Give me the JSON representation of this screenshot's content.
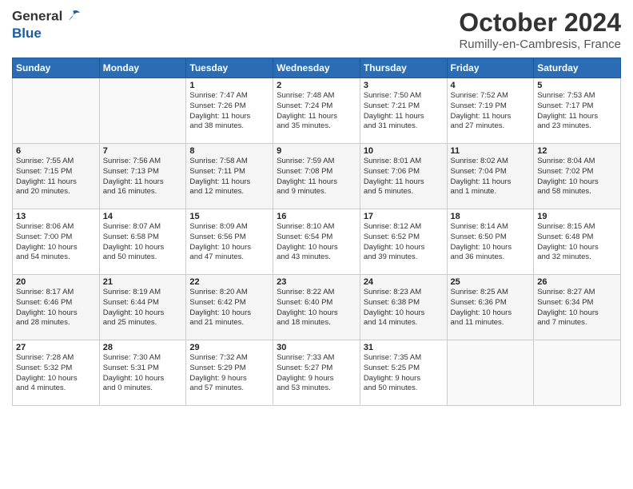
{
  "header": {
    "logo_line1": "General",
    "logo_line2": "Blue",
    "title": "October 2024",
    "subtitle": "Rumilly-en-Cambresis, France"
  },
  "calendar": {
    "days_of_week": [
      "Sunday",
      "Monday",
      "Tuesday",
      "Wednesday",
      "Thursday",
      "Friday",
      "Saturday"
    ],
    "weeks": [
      [
        {
          "day": "",
          "info": ""
        },
        {
          "day": "",
          "info": ""
        },
        {
          "day": "1",
          "info": "Sunrise: 7:47 AM\nSunset: 7:26 PM\nDaylight: 11 hours\nand 38 minutes."
        },
        {
          "day": "2",
          "info": "Sunrise: 7:48 AM\nSunset: 7:24 PM\nDaylight: 11 hours\nand 35 minutes."
        },
        {
          "day": "3",
          "info": "Sunrise: 7:50 AM\nSunset: 7:21 PM\nDaylight: 11 hours\nand 31 minutes."
        },
        {
          "day": "4",
          "info": "Sunrise: 7:52 AM\nSunset: 7:19 PM\nDaylight: 11 hours\nand 27 minutes."
        },
        {
          "day": "5",
          "info": "Sunrise: 7:53 AM\nSunset: 7:17 PM\nDaylight: 11 hours\nand 23 minutes."
        }
      ],
      [
        {
          "day": "6",
          "info": "Sunrise: 7:55 AM\nSunset: 7:15 PM\nDaylight: 11 hours\nand 20 minutes."
        },
        {
          "day": "7",
          "info": "Sunrise: 7:56 AM\nSunset: 7:13 PM\nDaylight: 11 hours\nand 16 minutes."
        },
        {
          "day": "8",
          "info": "Sunrise: 7:58 AM\nSunset: 7:11 PM\nDaylight: 11 hours\nand 12 minutes."
        },
        {
          "day": "9",
          "info": "Sunrise: 7:59 AM\nSunset: 7:08 PM\nDaylight: 11 hours\nand 9 minutes."
        },
        {
          "day": "10",
          "info": "Sunrise: 8:01 AM\nSunset: 7:06 PM\nDaylight: 11 hours\nand 5 minutes."
        },
        {
          "day": "11",
          "info": "Sunrise: 8:02 AM\nSunset: 7:04 PM\nDaylight: 11 hours\nand 1 minute."
        },
        {
          "day": "12",
          "info": "Sunrise: 8:04 AM\nSunset: 7:02 PM\nDaylight: 10 hours\nand 58 minutes."
        }
      ],
      [
        {
          "day": "13",
          "info": "Sunrise: 8:06 AM\nSunset: 7:00 PM\nDaylight: 10 hours\nand 54 minutes."
        },
        {
          "day": "14",
          "info": "Sunrise: 8:07 AM\nSunset: 6:58 PM\nDaylight: 10 hours\nand 50 minutes."
        },
        {
          "day": "15",
          "info": "Sunrise: 8:09 AM\nSunset: 6:56 PM\nDaylight: 10 hours\nand 47 minutes."
        },
        {
          "day": "16",
          "info": "Sunrise: 8:10 AM\nSunset: 6:54 PM\nDaylight: 10 hours\nand 43 minutes."
        },
        {
          "day": "17",
          "info": "Sunrise: 8:12 AM\nSunset: 6:52 PM\nDaylight: 10 hours\nand 39 minutes."
        },
        {
          "day": "18",
          "info": "Sunrise: 8:14 AM\nSunset: 6:50 PM\nDaylight: 10 hours\nand 36 minutes."
        },
        {
          "day": "19",
          "info": "Sunrise: 8:15 AM\nSunset: 6:48 PM\nDaylight: 10 hours\nand 32 minutes."
        }
      ],
      [
        {
          "day": "20",
          "info": "Sunrise: 8:17 AM\nSunset: 6:46 PM\nDaylight: 10 hours\nand 28 minutes."
        },
        {
          "day": "21",
          "info": "Sunrise: 8:19 AM\nSunset: 6:44 PM\nDaylight: 10 hours\nand 25 minutes."
        },
        {
          "day": "22",
          "info": "Sunrise: 8:20 AM\nSunset: 6:42 PM\nDaylight: 10 hours\nand 21 minutes."
        },
        {
          "day": "23",
          "info": "Sunrise: 8:22 AM\nSunset: 6:40 PM\nDaylight: 10 hours\nand 18 minutes."
        },
        {
          "day": "24",
          "info": "Sunrise: 8:23 AM\nSunset: 6:38 PM\nDaylight: 10 hours\nand 14 minutes."
        },
        {
          "day": "25",
          "info": "Sunrise: 8:25 AM\nSunset: 6:36 PM\nDaylight: 10 hours\nand 11 minutes."
        },
        {
          "day": "26",
          "info": "Sunrise: 8:27 AM\nSunset: 6:34 PM\nDaylight: 10 hours\nand 7 minutes."
        }
      ],
      [
        {
          "day": "27",
          "info": "Sunrise: 7:28 AM\nSunset: 5:32 PM\nDaylight: 10 hours\nand 4 minutes."
        },
        {
          "day": "28",
          "info": "Sunrise: 7:30 AM\nSunset: 5:31 PM\nDaylight: 10 hours\nand 0 minutes."
        },
        {
          "day": "29",
          "info": "Sunrise: 7:32 AM\nSunset: 5:29 PM\nDaylight: 9 hours\nand 57 minutes."
        },
        {
          "day": "30",
          "info": "Sunrise: 7:33 AM\nSunset: 5:27 PM\nDaylight: 9 hours\nand 53 minutes."
        },
        {
          "day": "31",
          "info": "Sunrise: 7:35 AM\nSunset: 5:25 PM\nDaylight: 9 hours\nand 50 minutes."
        },
        {
          "day": "",
          "info": ""
        },
        {
          "day": "",
          "info": ""
        }
      ]
    ]
  }
}
